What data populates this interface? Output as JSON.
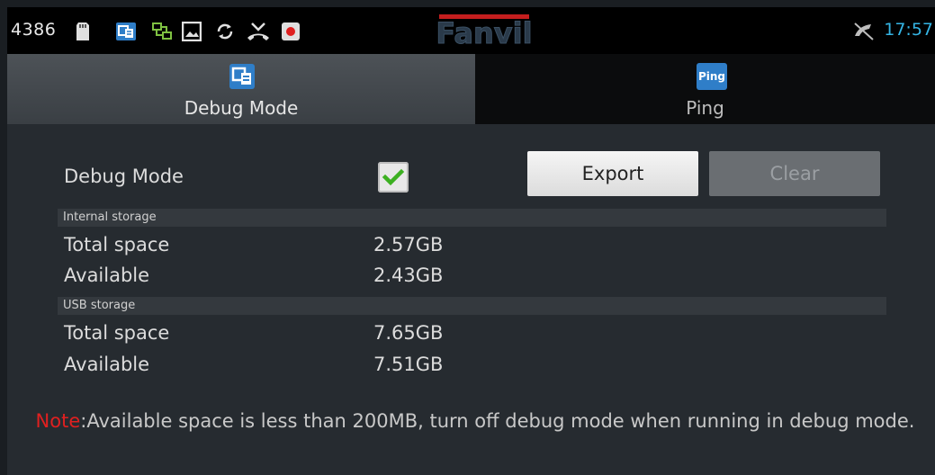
{
  "status_bar": {
    "extension": "4386",
    "time": "17:57",
    "brand": "Fanvil",
    "icons": [
      "sd-card-icon",
      "debug-mode-icon",
      "network-icon",
      "image-icon",
      "sync-icon",
      "missed-call-icon",
      "record-icon",
      "mute-icon"
    ]
  },
  "tabs": [
    {
      "label": "Debug Mode",
      "icon": "debug-mode-icon",
      "active": true
    },
    {
      "label": "Ping",
      "icon_text": "Ping",
      "active": false
    }
  ],
  "debug": {
    "label": "Debug Mode",
    "checked": true,
    "export_label": "Export",
    "clear_label": "Clear"
  },
  "internal_storage": {
    "header": "Internal storage",
    "total_label": "Total space",
    "total_value": "2.57GB",
    "available_label": "Available",
    "available_value": "2.43GB"
  },
  "usb_storage": {
    "header": "USB storage",
    "total_label": "Total space",
    "total_value": "7.65GB",
    "available_label": "Available",
    "available_value": "7.51GB"
  },
  "note": {
    "prefix": "Note",
    "text": ":Available space is less than 200MB, turn off debug mode when running in debug mode."
  },
  "colors": {
    "accent_time": "#35b5e5",
    "note_red": "#e02020",
    "check_green": "#3cb021"
  }
}
